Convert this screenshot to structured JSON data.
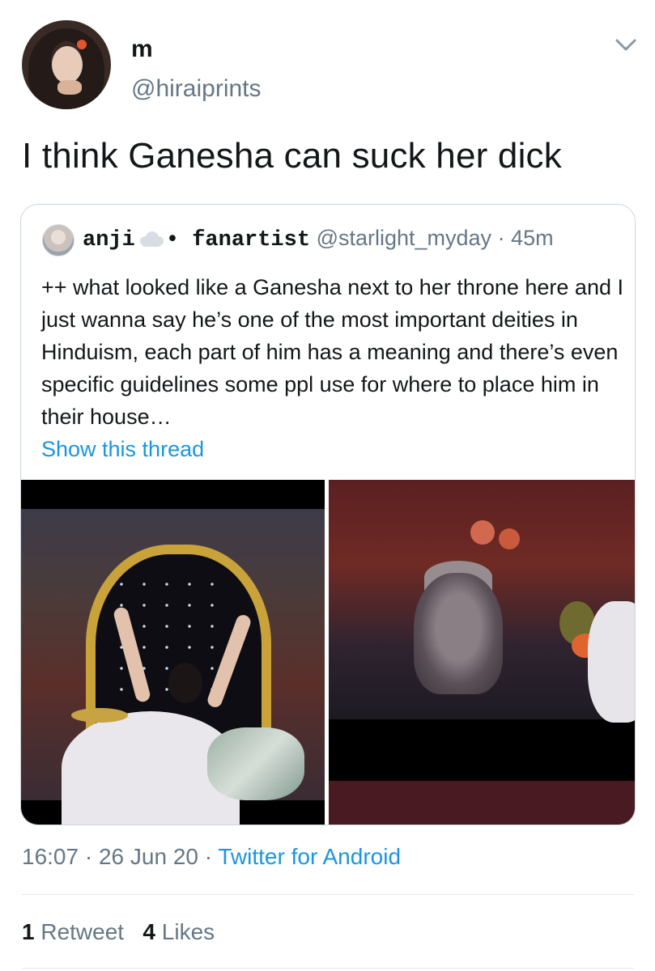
{
  "author": {
    "display_name": "m",
    "handle": "@hiraiprints"
  },
  "tweet": {
    "text": "I think Ganesha can suck her dick"
  },
  "quoted_tweet": {
    "name": "anji",
    "name_suffix": "• fanartist",
    "handle": "@starlight_myday",
    "separator": "·",
    "time": "45m",
    "text": "++ what looked like a Ganesha next to her throne here and I just wanna say he’s one of the most important deities in Hinduism, each part of him has a meaning and there’s even specific guidelines some ppl use for where to place him in their house…",
    "show_thread": "Show this thread"
  },
  "footer": {
    "time": "16:07",
    "separator": "·",
    "date": "26 Jun 20",
    "source": "Twitter for Android",
    "retweet_count": "1",
    "retweet_label": "Retweet",
    "like_count": "4",
    "like_label": "Likes"
  },
  "colors": {
    "link": "#1b95e0",
    "muted": "#657786",
    "text": "#14171a",
    "border": "#ccd6dd"
  },
  "icons": {
    "menu": "chevron-down-icon",
    "emoji": "cloud-icon"
  }
}
